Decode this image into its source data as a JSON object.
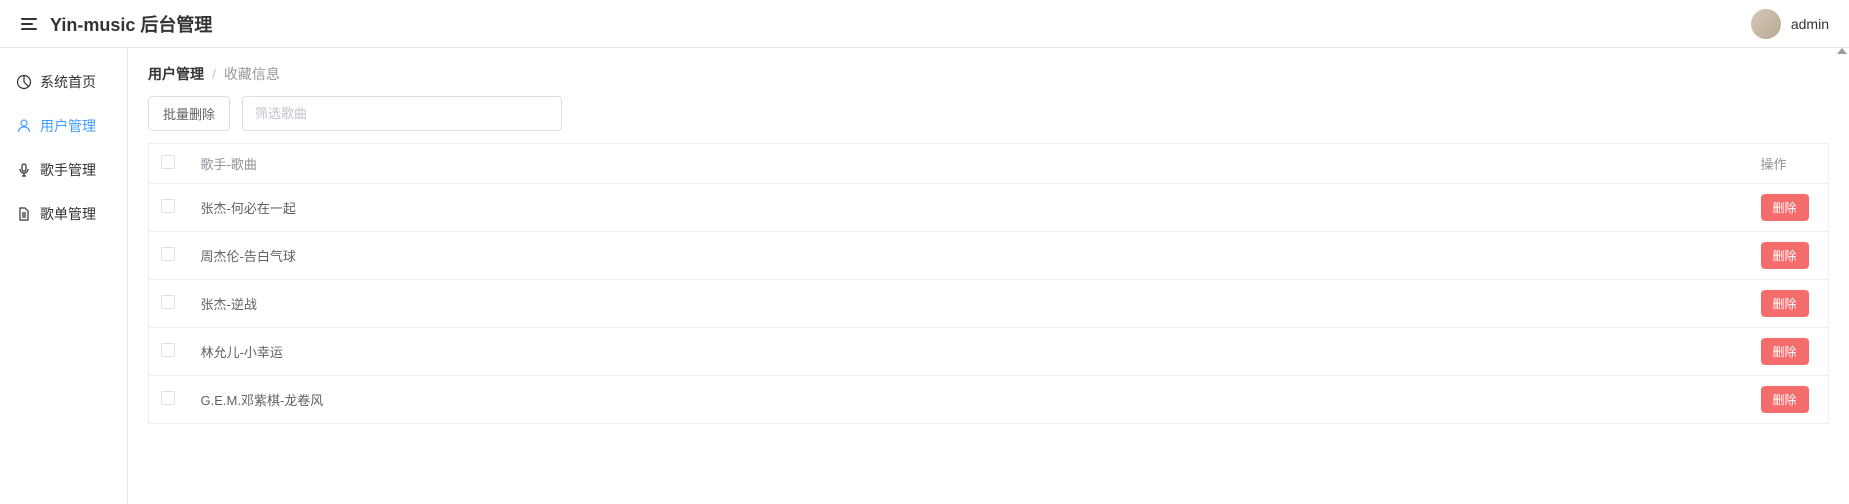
{
  "header": {
    "title": "Yin-music 后台管理",
    "username": "admin"
  },
  "sidebar": {
    "items": [
      {
        "label": "系统首页",
        "icon": "pie"
      },
      {
        "label": "用户管理",
        "icon": "user",
        "active": true
      },
      {
        "label": "歌手管理",
        "icon": "mic"
      },
      {
        "label": "歌单管理",
        "icon": "doc"
      }
    ]
  },
  "breadcrumb": {
    "main": "用户管理",
    "sub": "收藏信息"
  },
  "toolbar": {
    "batch_delete": "批量删除",
    "filter_placeholder": "筛选歌曲"
  },
  "table": {
    "columns": {
      "song": "歌手-歌曲",
      "action": "操作"
    },
    "delete_label": "删除",
    "rows": [
      {
        "song": "张杰-何必在一起"
      },
      {
        "song": "周杰伦-告白气球"
      },
      {
        "song": "张杰-逆战"
      },
      {
        "song": "林允儿-小幸运"
      },
      {
        "song": "G.E.M.邓紫棋-龙卷风"
      }
    ]
  }
}
